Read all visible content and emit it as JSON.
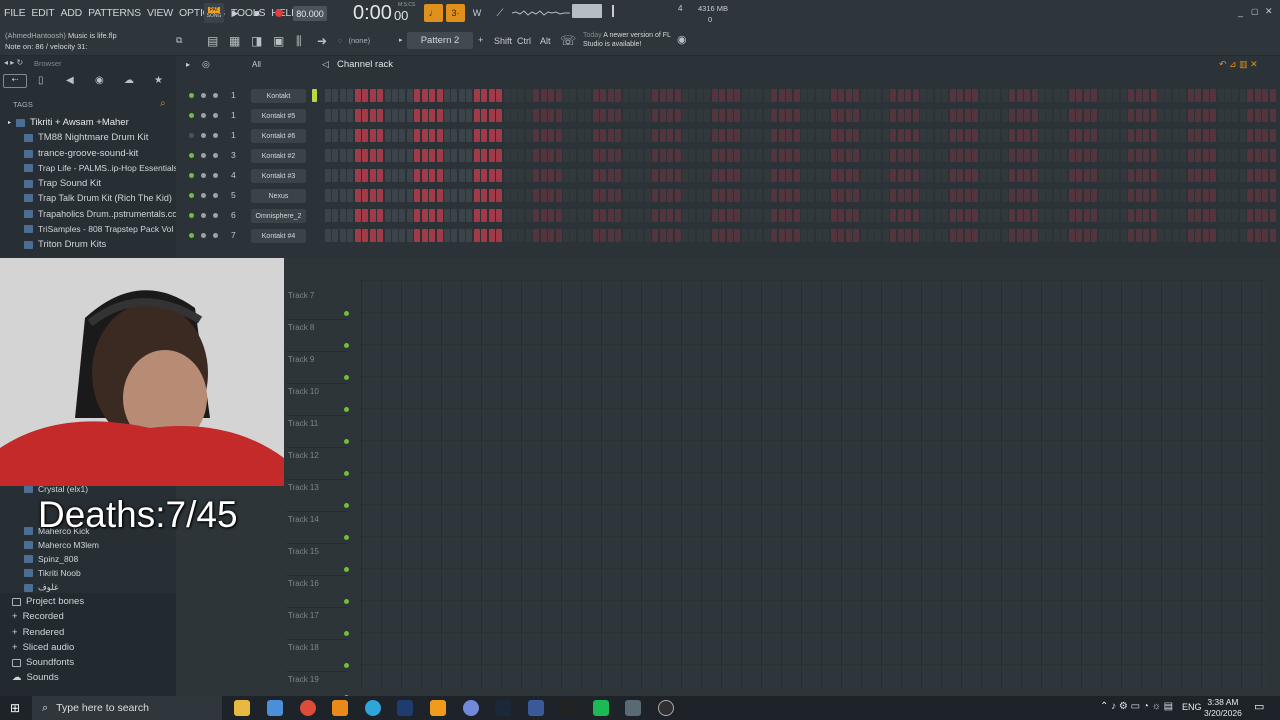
{
  "menu": [
    "FILE",
    "EDIT",
    "ADD",
    "PATTERNS",
    "VIEW",
    "OPTIONS",
    "TOOLS",
    "HELP"
  ],
  "transport": {
    "pat_label": "PAT",
    "song_label": "SONG",
    "tempo": "80.000",
    "time": "0:00",
    "time_sub": "00",
    "time_units": "M:S:CS",
    "beat_top": "4",
    "cpu_mem": "4316 MB",
    "poly": "0"
  },
  "project": {
    "user": "(AhmedHantoosh)",
    "file": "Music is life.flp",
    "hint": "Note on: 86 / velocity 31:"
  },
  "toolbar": {
    "pattern_channel": "(none)",
    "pattern": "Pattern 2",
    "shift": "Shift",
    "ctrl": "Ctrl",
    "alt": "Alt",
    "news_label": "Today",
    "news": "A newer version of FL Studio is available!"
  },
  "browser": {
    "title": "Browser",
    "tags_label": "TAGS",
    "items": [
      "Tikriti + Awsam +Maher",
      "TM88 Nightmare Drum Kit",
      "trance-groove-sound-kit",
      "Trap Life - PALMS..ip-Hop Essentials 1",
      "Trap Sound Kit",
      "Trap Talk Drum Kit (Rich The Kid)",
      "Trapaholics Drum..pstrumentals.com)",
      "TriSamples - 808 Trapstep Pack Vol 1",
      "Triton Drum Kits"
    ],
    "sub_items": [
      "Crystal (elx1)",
      "Maherco Kick",
      "Maherco M3lem",
      "Spinz_808",
      "Tikriti Noob",
      "غلوف"
    ],
    "folders": [
      "Project bones",
      "Recorded",
      "Rendered",
      "Sliced audio",
      "Soundfonts",
      "Sounds"
    ]
  },
  "rack": {
    "filter": "All",
    "title": "Channel rack",
    "channels": [
      {
        "num": "1",
        "name": "Kontakt"
      },
      {
        "num": "1",
        "name": "Kontakt #5"
      },
      {
        "num": "1",
        "name": "Kontakt #6"
      },
      {
        "num": "3",
        "name": "Kontakt #2"
      },
      {
        "num": "4",
        "name": "Kontakt #3"
      },
      {
        "num": "5",
        "name": "Nexus"
      },
      {
        "num": "6",
        "name": "Omnisphere_2"
      },
      {
        "num": "7",
        "name": "Kontakt #4"
      }
    ]
  },
  "playlist": {
    "tracks": [
      "Track 7",
      "Track 8",
      "Track 9",
      "Track 10",
      "Track 11",
      "Track 12",
      "Track 13",
      "Track 14",
      "Track 15",
      "Track 16",
      "Track 17",
      "Track 18",
      "Track 19"
    ]
  },
  "overlay": {
    "deaths": "Deaths:7/45"
  },
  "taskbar": {
    "search_placeholder": "Type here to search",
    "lang": "ENG",
    "time": "3:38 AM",
    "date": "3/20/2026"
  },
  "colors": {
    "accent_orange": "#f0a020",
    "step_red": "#a23a47",
    "step_dark": "#3b4549",
    "led_green": "#6fbf3d"
  }
}
